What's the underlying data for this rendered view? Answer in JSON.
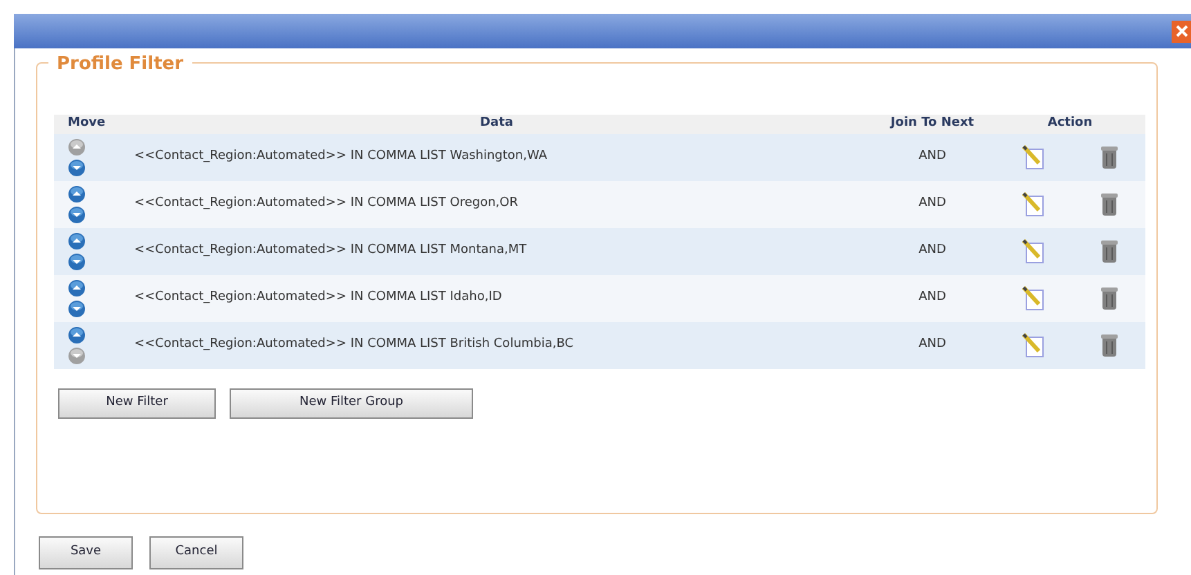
{
  "fieldset": {
    "legend": "Profile Filter"
  },
  "table": {
    "columns": [
      "Move",
      "Data",
      "Join To Next",
      "Action"
    ],
    "rows": [
      {
        "data": "<<Contact_Region:Automated>> IN COMMA LIST Washington,WA",
        "join": "AND",
        "up_enabled": false,
        "down_enabled": true
      },
      {
        "data": "<<Contact_Region:Automated>> IN COMMA LIST Oregon,OR",
        "join": "AND",
        "up_enabled": true,
        "down_enabled": true
      },
      {
        "data": "<<Contact_Region:Automated>> IN COMMA LIST Montana,MT",
        "join": "AND",
        "up_enabled": true,
        "down_enabled": true
      },
      {
        "data": "<<Contact_Region:Automated>> IN COMMA LIST Idaho,ID",
        "join": "AND",
        "up_enabled": true,
        "down_enabled": true
      },
      {
        "data": "<<Contact_Region:Automated>> IN COMMA LIST British Columbia,BC",
        "join": "AND",
        "up_enabled": true,
        "down_enabled": false
      }
    ]
  },
  "filter_buttons": [
    "New Filter",
    "New Filter Group"
  ],
  "footer_buttons": [
    "Save",
    "Cancel"
  ]
}
